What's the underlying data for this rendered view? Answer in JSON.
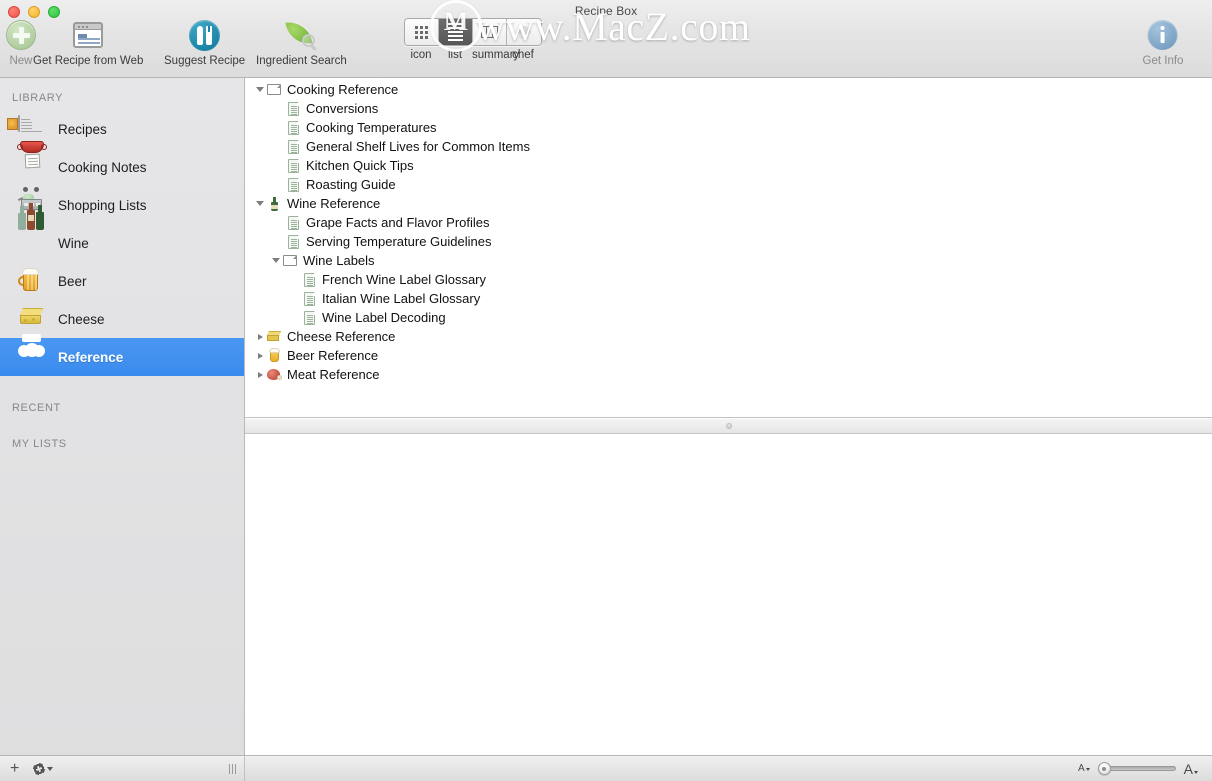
{
  "window": {
    "title": "Recipe Box",
    "traffic_lights": [
      "close",
      "minimize",
      "zoom"
    ]
  },
  "watermark": {
    "logo_letter": "M",
    "text": "www.MacZ.com"
  },
  "toolbar": {
    "items": [
      {
        "label": "New",
        "icon": "plus-circle-icon",
        "dim": true
      },
      {
        "label": "Get Recipe from Web",
        "icon": "browser-window-icon",
        "dim": false
      },
      {
        "label": "Suggest Recipe",
        "icon": "spoon-fork-icon",
        "dim": false
      },
      {
        "label": "Ingredient Search",
        "icon": "leaf-magnifier-icon",
        "dim": false
      }
    ],
    "view_modes": [
      {
        "label": "icon",
        "icon": "grid-view-icon",
        "selected": false
      },
      {
        "label": "list",
        "icon": "list-view-icon",
        "selected": true
      },
      {
        "label": "summary",
        "icon": "columns-view-icon",
        "selected": false
      },
      {
        "label": "chef",
        "icon": "chef-hat-view-icon",
        "selected": false
      }
    ],
    "get_info": {
      "label": "Get Info",
      "icon": "info-circle-icon"
    }
  },
  "sidebar": {
    "sections": [
      {
        "header": "LIBRARY",
        "items": [
          {
            "label": "Recipes",
            "icon": "recipe-card-icon",
            "selected": false
          },
          {
            "label": "Cooking Notes",
            "icon": "cooking-pot-icon",
            "selected": false
          },
          {
            "label": "Shopping Lists",
            "icon": "shopping-cart-icon",
            "selected": false
          },
          {
            "label": "Wine",
            "icon": "wine-bottles-icon",
            "selected": false
          },
          {
            "label": "Beer",
            "icon": "beer-mug-icon",
            "selected": false
          },
          {
            "label": "Cheese",
            "icon": "cheese-wedge-icon",
            "selected": false
          },
          {
            "label": "Reference",
            "icon": "chef-hat-icon",
            "selected": true
          }
        ]
      },
      {
        "header": "RECENT",
        "items": []
      },
      {
        "header": "MY LISTS",
        "items": []
      }
    ],
    "selection_color": "#3a8bee"
  },
  "tree": {
    "rows": [
      {
        "label": "Cooking Reference",
        "icon": "folder-icon",
        "level": 0,
        "disclosure": "open"
      },
      {
        "label": "Conversions",
        "icon": "document-icon",
        "level": 1,
        "disclosure": "none"
      },
      {
        "label": "Cooking Temperatures",
        "icon": "document-icon",
        "level": 1,
        "disclosure": "none"
      },
      {
        "label": "General Shelf Lives for Common Items",
        "icon": "document-icon",
        "level": 1,
        "disclosure": "none"
      },
      {
        "label": "Kitchen Quick Tips",
        "icon": "document-icon",
        "level": 1,
        "disclosure": "none"
      },
      {
        "label": "Roasting Guide",
        "icon": "document-icon",
        "level": 1,
        "disclosure": "none"
      },
      {
        "label": "Wine Reference",
        "icon": "wine-bottle-icon",
        "level": 0,
        "disclosure": "open"
      },
      {
        "label": "Grape Facts and Flavor Profiles",
        "icon": "document-icon",
        "level": 1,
        "disclosure": "none"
      },
      {
        "label": "Serving Temperature Guidelines",
        "icon": "document-icon",
        "level": 1,
        "disclosure": "none"
      },
      {
        "label": "Wine Labels",
        "icon": "folder-icon",
        "level": 1,
        "disclosure": "open"
      },
      {
        "label": "French Wine Label Glossary",
        "icon": "document-icon",
        "level": 2,
        "disclosure": "none"
      },
      {
        "label": "Italian Wine Label Glossary",
        "icon": "document-icon",
        "level": 2,
        "disclosure": "none"
      },
      {
        "label": "Wine Label Decoding",
        "icon": "document-icon",
        "level": 2,
        "disclosure": "none"
      },
      {
        "label": "Cheese Reference",
        "icon": "cheese-icon",
        "level": 0,
        "disclosure": "closed"
      },
      {
        "label": "Beer Reference",
        "icon": "beer-glass-icon",
        "level": 0,
        "disclosure": "closed"
      },
      {
        "label": "Meat Reference",
        "icon": "meat-icon",
        "level": 0,
        "disclosure": "closed"
      }
    ]
  },
  "statusbar": {
    "add_label": "+",
    "action_menu": "gear-icon",
    "text_size_small": "A",
    "text_size_large": "A",
    "slider_value": 0
  }
}
